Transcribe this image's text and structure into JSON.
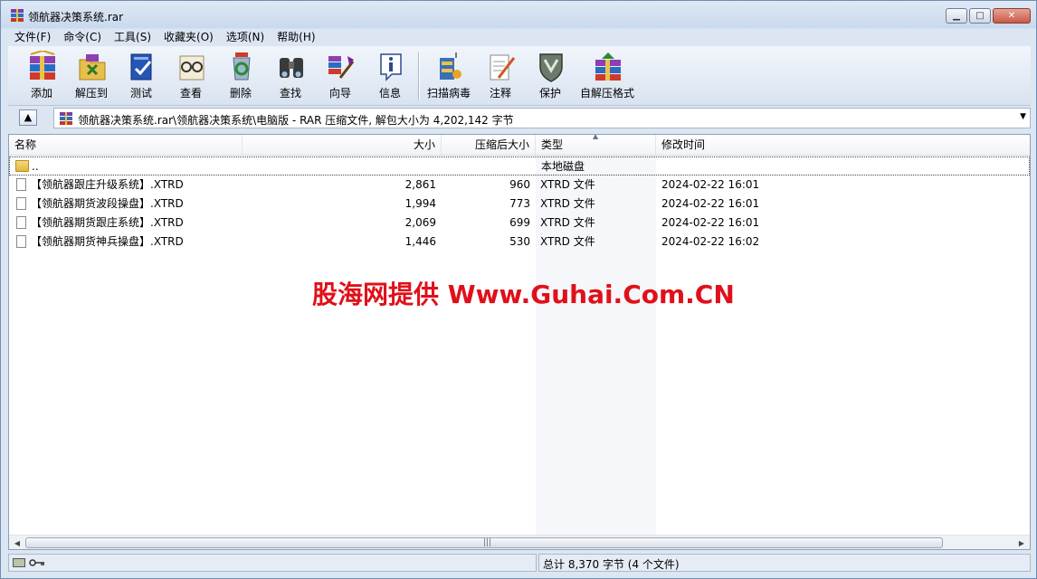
{
  "window": {
    "title": "领航器决策系统.rar",
    "buttons": {
      "minimize": "▁",
      "maximize": "□",
      "close": "✕"
    }
  },
  "menu": [
    "文件(F)",
    "命令(C)",
    "工具(S)",
    "收藏夹(O)",
    "选项(N)",
    "帮助(H)"
  ],
  "toolbar": [
    {
      "label": "添加",
      "icon": "add-books-icon"
    },
    {
      "label": "解压到",
      "icon": "extract-folder-icon"
    },
    {
      "label": "测试",
      "icon": "test-book-icon"
    },
    {
      "label": "查看",
      "icon": "view-glasses-icon"
    },
    {
      "label": "删除",
      "icon": "delete-recycle-icon"
    },
    {
      "label": "查找",
      "icon": "find-binoculars-icon"
    },
    {
      "label": "向导",
      "icon": "wizard-icon"
    },
    {
      "label": "信息",
      "icon": "info-icon"
    },
    {
      "label": "扫描病毒",
      "icon": "scan-virus-icon"
    },
    {
      "label": "注释",
      "icon": "comment-pen-icon"
    },
    {
      "label": "保护",
      "icon": "protect-shield-icon"
    },
    {
      "label": "自解压格式",
      "icon": "sfx-icon"
    }
  ],
  "address": {
    "text": "领航器决策系统.rar\\领航器决策系统\\电脑版 - RAR 压缩文件, 解包大小为 4,202,142 字节"
  },
  "columns": {
    "name": "名称",
    "size": "大小",
    "packed": "压缩后大小",
    "type": "类型",
    "modified": "修改时间"
  },
  "parent_row": {
    "name": "..",
    "type": "本地磁盘"
  },
  "files": [
    {
      "name": "【领航器跟庄升级系统】.XTRD",
      "size": "2,861",
      "packed": "960",
      "type": "XTRD 文件",
      "modified": "2024-02-22 16:01"
    },
    {
      "name": "【领航器期货波段操盘】.XTRD",
      "size": "1,994",
      "packed": "773",
      "type": "XTRD 文件",
      "modified": "2024-02-22 16:01"
    },
    {
      "name": "【领航器期货跟庄系统】.XTRD",
      "size": "2,069",
      "packed": "699",
      "type": "XTRD 文件",
      "modified": "2024-02-22 16:01"
    },
    {
      "name": "【领航器期货神兵操盘】.XTRD",
      "size": "1,446",
      "packed": "530",
      "type": "XTRD 文件",
      "modified": "2024-02-22 16:02"
    }
  ],
  "watermark": "股海网提供 Www.Guhai.Com.CN",
  "status": {
    "summary": "总计 8,370 字节 (4 个文件)"
  }
}
